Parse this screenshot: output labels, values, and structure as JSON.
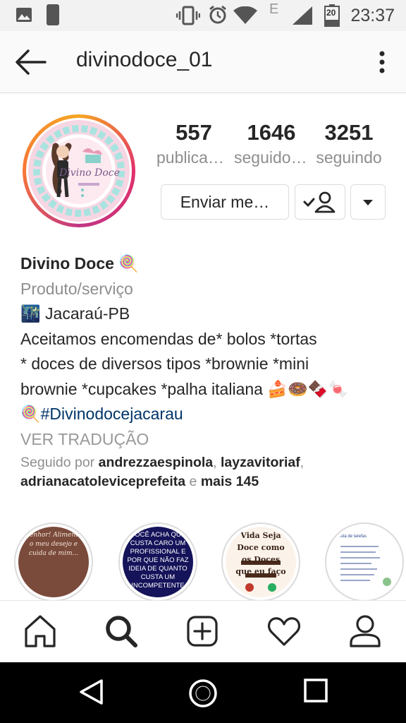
{
  "status_bar": {
    "time": "23:37",
    "network": "E",
    "battery": "20"
  },
  "header": {
    "username": "divinodoce_01"
  },
  "profile": {
    "avatar_logo_text": "Divino Doce",
    "stats": [
      {
        "value": "557",
        "label": "publicações"
      },
      {
        "value": "1646",
        "label": "seguidores"
      },
      {
        "value": "3251",
        "label": "seguindo"
      }
    ],
    "message_button": "Enviar me…"
  },
  "bio": {
    "name": "Divino Doce",
    "name_emoji": "🍭",
    "category": "Produto/serviço",
    "location_emoji": "🌃",
    "location": " Jacaraú-PB",
    "line1": "Aceitamos encomendas de* bolos *tortas",
    "line2": "* doces de diversos tipos *brownie *mini",
    "line3": "brownie *cupcakes *palha italiana",
    "line3_emojis": " 🍰🍩🍫🍬",
    "hashtag_emoji": "🍭",
    "hashtag": "#Divinodocejacarau",
    "translate": "VER TRADUÇÃO"
  },
  "followed_by": {
    "prefix": "Seguido por ",
    "user1": "andrezzaespinola",
    "sep1": ", ",
    "user2": "layzavitoriaf",
    "sep2": ",",
    "user3": "adrianacatoleviceprefeita",
    "and": " e ",
    "more": "mais 145"
  },
  "highlights": [
    {
      "text": "Senhor! Alimente o meu desejo e cuida de mim..."
    },
    {
      "text": "VOCÊ ACHA QUE CUSTA CARO UM PROFISSIONAL E POR QUE NÃO FAZ IDEIA DE QUANTO CUSTA UM INCOMPETENTE"
    },
    {
      "text": "Vida Seja Doce como os Doces que eu faço"
    },
    {
      "text": "lista de tarefas"
    }
  ],
  "colors": {
    "accent_link": "#003569",
    "secondary_text": "#8e8e8e"
  }
}
